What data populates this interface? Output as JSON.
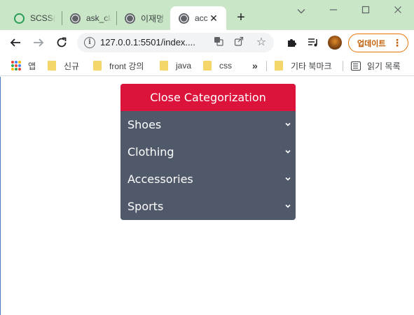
{
  "tabs": [
    {
      "title": "SCSS(S",
      "icon": "scss-favicon-icon",
      "active": false
    },
    {
      "title": "ask_cla",
      "icon": "globe-icon",
      "active": false
    },
    {
      "title": "이재명",
      "icon": "globe-icon",
      "active": false
    },
    {
      "title": "acc",
      "icon": "globe-icon",
      "active": true
    }
  ],
  "toolbar": {
    "url": "127.0.0.1:5501/index....",
    "update_label": "업데이트"
  },
  "bookmarks": {
    "apps": "앱",
    "items": [
      "신규",
      "front 강의",
      "java",
      "css"
    ],
    "overflow": "»",
    "other": "기타 북마크",
    "reading_list": "읽기 목록"
  },
  "menu": {
    "header": "Close Categorization",
    "items": [
      "Shoes",
      "Clothing",
      "Accessories",
      "Sports"
    ]
  },
  "colors": {
    "tabstrip": "#c9e6c6",
    "header_bg": "#dc143c",
    "menu_bg": "#50596a",
    "update_accent": "#e37400"
  }
}
